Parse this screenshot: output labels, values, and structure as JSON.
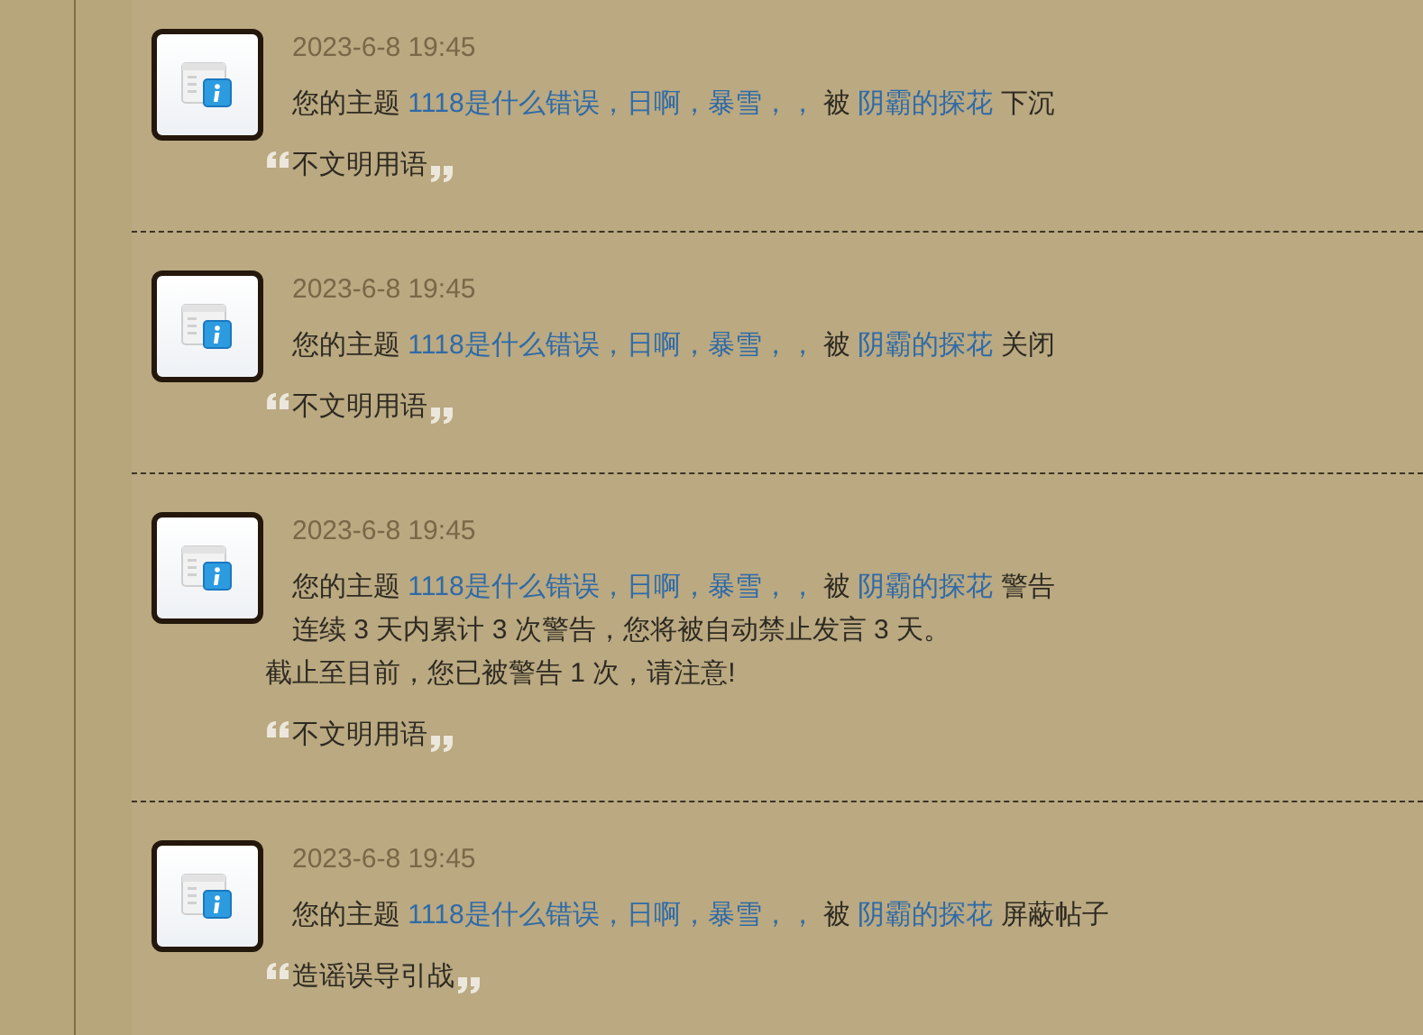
{
  "notifications": [
    {
      "time": "2023-6-8 19:45",
      "prefix": "您的主题",
      "topic": "1118是什么错误，日啊，暴雪，，",
      "by": "被",
      "user": "阴霸的探花",
      "action": "下沉",
      "reason": "不文明用语"
    },
    {
      "time": "2023-6-8 19:45",
      "prefix": "您的主题",
      "topic": "1118是什么错误，日啊，暴雪，，",
      "by": "被",
      "user": "阴霸的探花",
      "action": "关闭",
      "reason": "不文明用语"
    },
    {
      "time": "2023-6-8 19:45",
      "prefix": "您的主题",
      "topic": "1118是什么错误，日啊，暴雪，，",
      "by": "被",
      "user": "阴霸的探花",
      "action": "警告",
      "details": [
        "连续 3 天内累计 3 次警告，您将被自动禁止发言 3 天。",
        "截止至目前，您已被警告 1 次，请注意!"
      ],
      "reason": "不文明用语"
    },
    {
      "time": "2023-6-8 19:45",
      "prefix": "您的主题",
      "topic": "1118是什么错误，日啊，暴雪，，",
      "by": "被",
      "user": "阴霸的探花",
      "action": "屏蔽帖子",
      "reason": "造谣误导引战"
    }
  ]
}
